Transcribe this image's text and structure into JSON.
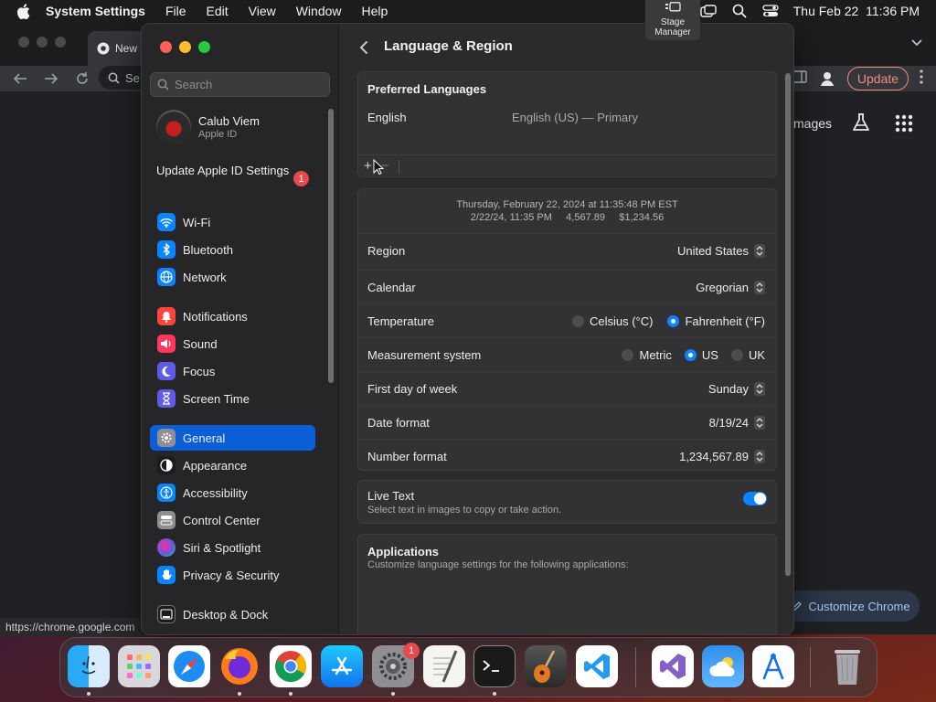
{
  "menubar": {
    "app_name": "System Settings",
    "items": [
      "File",
      "Edit",
      "View",
      "Window",
      "Help"
    ],
    "datetime": "Thu Feb 22  11:36 PM",
    "stage_manager": "Stage Manager"
  },
  "chrome": {
    "tab_title": "New",
    "omnibox_text": "Se",
    "update_label": "Update",
    "images_link": "mages",
    "customize_label": "Customize Chrome",
    "status_url": "https://chrome.google.com"
  },
  "sidebar": {
    "search_placeholder": "Search",
    "profile_name": "Calub Viem",
    "profile_sub": "Apple ID",
    "update_apple_id": "Update Apple ID Settings",
    "update_badge": "1",
    "items": [
      {
        "label": "Wi-Fi",
        "icon": "wifi-icon",
        "color": "#0a84ff"
      },
      {
        "label": "Bluetooth",
        "icon": "bluetooth-icon",
        "color": "#0a84ff"
      },
      {
        "label": "Network",
        "icon": "globe-icon",
        "color": "#0a84ff"
      },
      {
        "label": "Notifications",
        "icon": "bell-icon",
        "color": "#ff453a"
      },
      {
        "label": "Sound",
        "icon": "speaker-icon",
        "color": "#ff375f"
      },
      {
        "label": "Focus",
        "icon": "moon-icon",
        "color": "#5e5ce6"
      },
      {
        "label": "Screen Time",
        "icon": "hourglass-icon",
        "color": "#5e5ce6"
      },
      {
        "label": "General",
        "icon": "gear-icon",
        "color": "#8e8e93"
      },
      {
        "label": "Appearance",
        "icon": "appearance-icon",
        "color": "#1c1c1e"
      },
      {
        "label": "Accessibility",
        "icon": "accessibility-icon",
        "color": "#0a84ff"
      },
      {
        "label": "Control Center",
        "icon": "control-center-icon",
        "color": "#8e8e93"
      },
      {
        "label": "Siri & Spotlight",
        "icon": "siri-icon",
        "color": "#bf5af2"
      },
      {
        "label": "Privacy & Security",
        "icon": "hand-icon",
        "color": "#0a84ff"
      },
      {
        "label": "Desktop & Dock",
        "icon": "dock-icon",
        "color": "#1c1c1e"
      }
    ],
    "active_item": "General"
  },
  "main": {
    "title": "Language & Region",
    "preferred_languages": {
      "header": "Preferred Languages",
      "language": "English",
      "language_detail": "English (US) — Primary",
      "add": "+",
      "remove": "−"
    },
    "format_preview": {
      "line1": "Thursday, February 22, 2024 at 11:35:48 PM EST",
      "line2": "2/22/24, 11:35 PM     4,567.89     $1,234.56"
    },
    "rows": {
      "region": {
        "label": "Region",
        "value": "United States"
      },
      "calendar": {
        "label": "Calendar",
        "value": "Gregorian"
      },
      "temperature": {
        "label": "Temperature",
        "opt1": "Celsius (°C)",
        "opt2": "Fahrenheit (°F)",
        "selected": "Fahrenheit (°F)"
      },
      "measurement": {
        "label": "Measurement system",
        "opt1": "Metric",
        "opt2": "US",
        "opt3": "UK",
        "selected": "US"
      },
      "first_day": {
        "label": "First day of week",
        "value": "Sunday"
      },
      "date_format": {
        "label": "Date format",
        "value": "8/19/24"
      },
      "number_format": {
        "label": "Number format",
        "value": "1,234,567.89"
      }
    },
    "live_text": {
      "label": "Live Text",
      "description": "Select text in images to copy or take action.",
      "enabled": true
    },
    "applications": {
      "header": "Applications",
      "description": "Customize language settings for the following applications:",
      "add": "+",
      "remove": "−"
    }
  },
  "dock": {
    "apps": [
      "Finder",
      "Launchpad",
      "Safari",
      "Firefox",
      "Chrome",
      "App Store",
      "System Settings",
      "TextEdit",
      "Terminal",
      "GarageBand",
      "VS Code",
      "Visual Studio",
      "Weather",
      "Xcode Instruments",
      "Trash"
    ],
    "settings_badge": "1"
  },
  "colors": {
    "accent": "#0a84ff",
    "sidebar_active": "#0a5fd6",
    "badge": "#e5484d",
    "chrome_update": "#f28b82"
  }
}
